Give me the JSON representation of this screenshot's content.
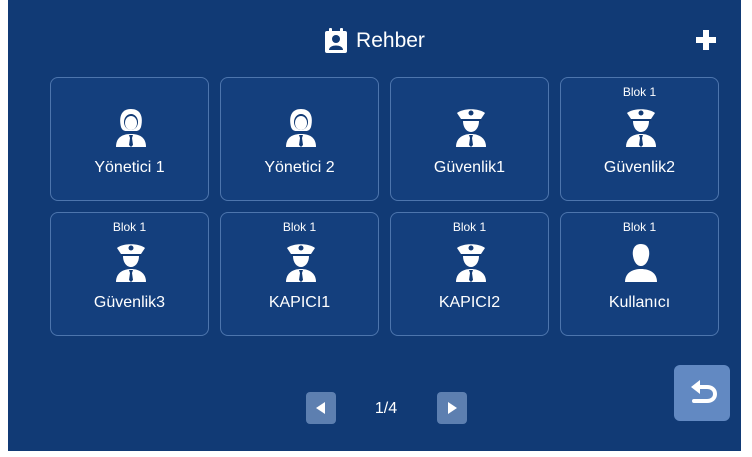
{
  "header": {
    "title": "Rehber",
    "add_icon": "plus-icon",
    "title_icon": "contacts-book-icon"
  },
  "contacts": [
    {
      "group": "",
      "name": "Yönetici 1",
      "icon": "female-manager-icon"
    },
    {
      "group": "",
      "name": "Yönetici 2",
      "icon": "female-manager-icon"
    },
    {
      "group": "",
      "name": "Güvenlik1",
      "icon": "security-guard-icon"
    },
    {
      "group": "Blok 1",
      "name": "Güvenlik2",
      "icon": "security-guard-icon"
    },
    {
      "group": "Blok 1",
      "name": "Güvenlik3",
      "icon": "security-guard-icon"
    },
    {
      "group": "Blok 1",
      "name": "KAPICI1",
      "icon": "security-guard-icon"
    },
    {
      "group": "Blok 1",
      "name": "KAPICI2",
      "icon": "security-guard-icon"
    },
    {
      "group": "Blok 1",
      "name": "Kullanıcı",
      "icon": "user-icon"
    }
  ],
  "pagination": {
    "current": "1/4"
  },
  "colors": {
    "background": "#113a75",
    "card_border": "#4d75ad",
    "button": "#5d7fb0",
    "back_button": "#6289c2"
  }
}
